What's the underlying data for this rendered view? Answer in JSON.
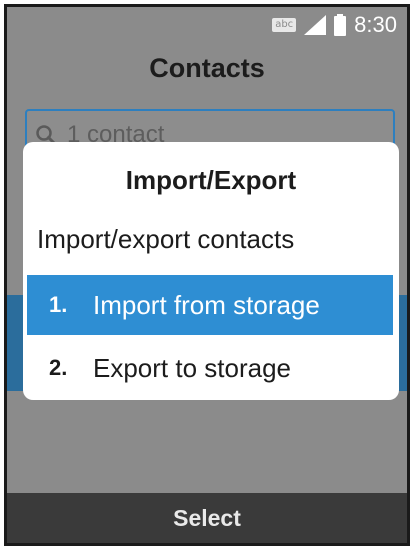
{
  "status_bar": {
    "input_mode": "abc",
    "icons": [
      "abc-icon",
      "signal-icon",
      "battery-icon"
    ],
    "time": "8:30"
  },
  "header": {
    "title": "Contacts"
  },
  "search": {
    "placeholder": "1 contact",
    "icon": "search-icon"
  },
  "dialog": {
    "title": "Import/Export",
    "subtitle": "Import/export contacts",
    "options": [
      {
        "number": "1.",
        "label": "Import from storage",
        "selected": true
      },
      {
        "number": "2.",
        "label": "Export to storage",
        "selected": false
      }
    ]
  },
  "softkeys": {
    "center": "Select"
  },
  "colors": {
    "accent": "#2e8ed3",
    "overlay": "#8b8b8b",
    "softkey_bar": "#3a3a3a",
    "search_border": "#2d7fbf"
  }
}
